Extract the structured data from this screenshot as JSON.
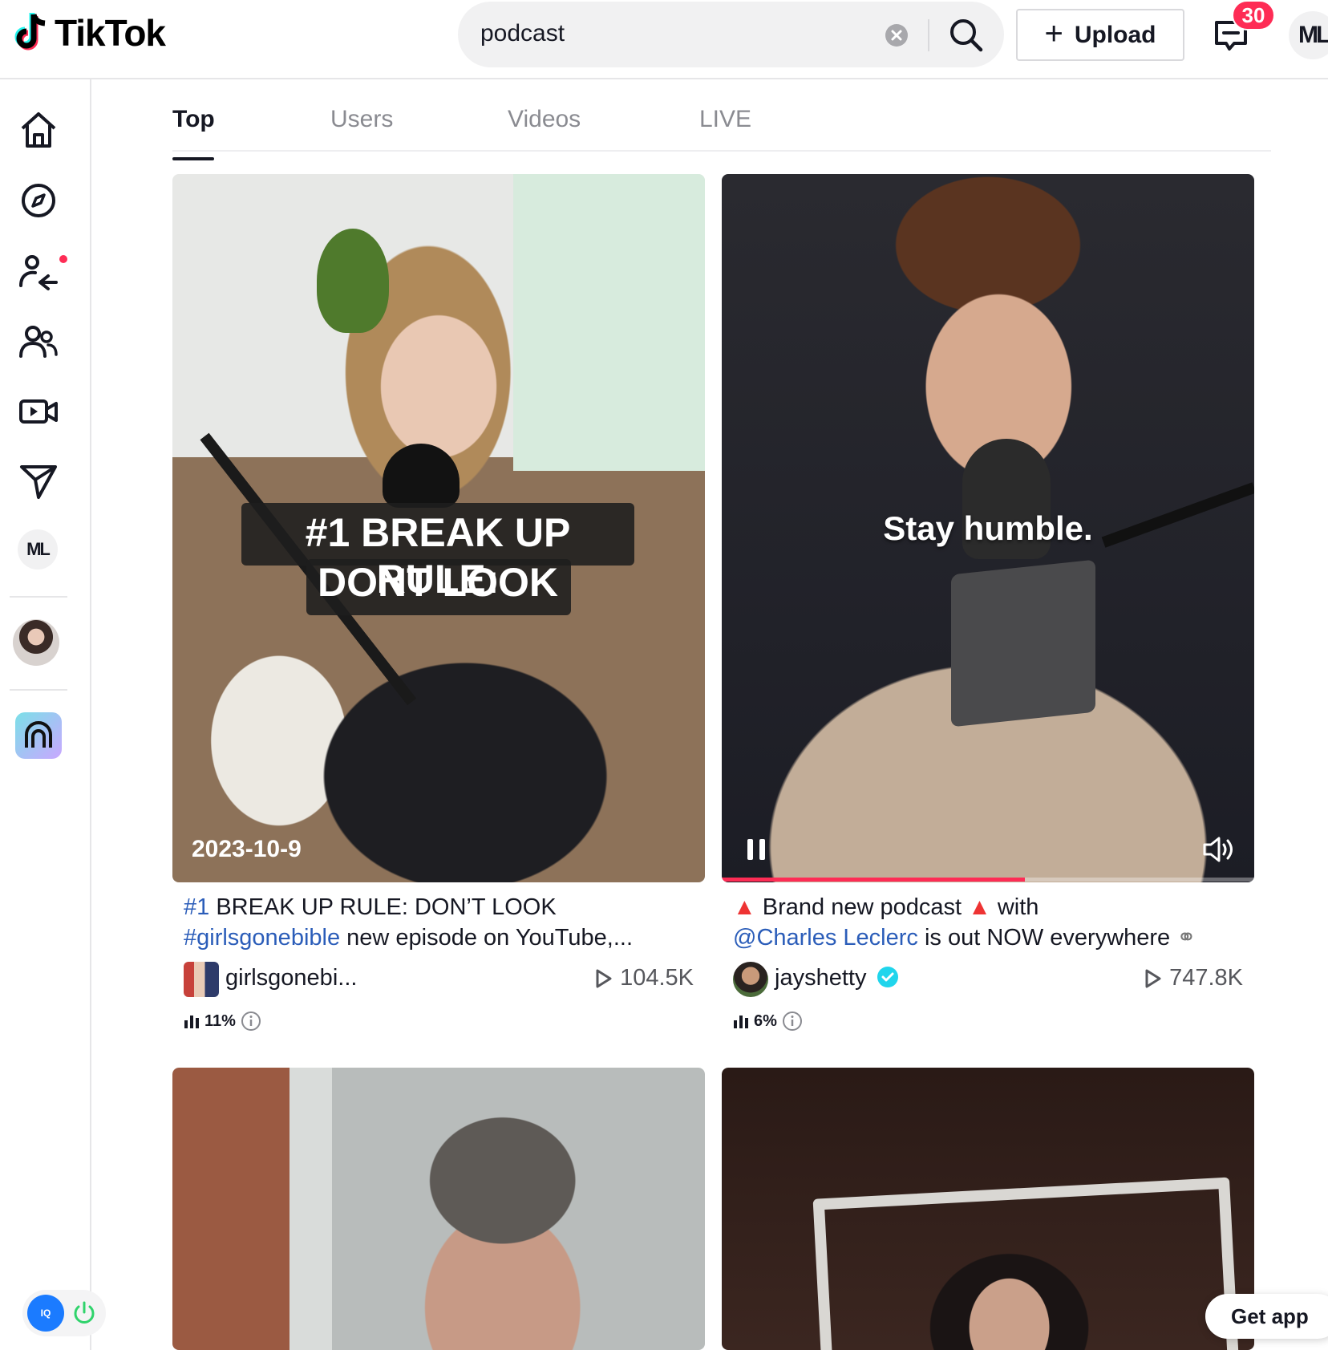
{
  "brand": {
    "name": "TikTok"
  },
  "search": {
    "value": "podcast",
    "placeholder": "Search"
  },
  "header": {
    "upload_label": "Upload",
    "inbox_count": "30",
    "user_initials": "ML"
  },
  "sidebar": {
    "user_initials": "ML"
  },
  "tabs": [
    {
      "label": "Top",
      "active": true
    },
    {
      "label": "Users",
      "active": false
    },
    {
      "label": "Videos",
      "active": false
    },
    {
      "label": "LIVE",
      "active": false
    }
  ],
  "videos": [
    {
      "overlay_line1": "#1 BREAK UP RULE:",
      "overlay_line2": "DONT LOOK",
      "date": "2023-10-9",
      "desc_hash1": "#1",
      "desc_text1": " BREAK UP RULE: DON’T LOOK",
      "desc_hash2": "#girlsgonebible",
      "desc_text2": " new episode on YouTube,...",
      "author": "girlsgonebi...",
      "views": "104.5K",
      "stat": "11%"
    },
    {
      "overlay_line1": "Stay humble.",
      "desc_text1": " Brand new podcast ",
      "desc_text1b": " with",
      "desc_mention": "@Charles Leclerc",
      "desc_text2": " is out NOW everywhere ",
      "author": "jayshetty",
      "verified": true,
      "views": "747.8K",
      "stat": "6%",
      "progress": 0.57
    },
    {},
    {}
  ],
  "get_app_label": "Get app",
  "extension": {
    "label": "IQ"
  },
  "colors": {
    "accent": "#fe2c55",
    "link": "#2b5db9",
    "verified": "#20d5ec"
  }
}
